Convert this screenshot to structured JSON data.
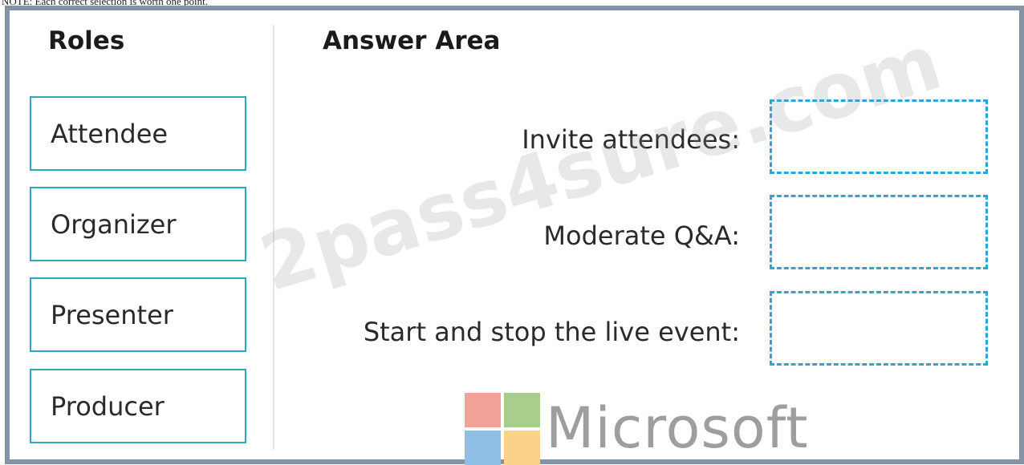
{
  "header_text": "NOTE: Each correct selection is worth one point.",
  "roles_panel": {
    "title": "Roles",
    "items": [
      {
        "label": "Attendee"
      },
      {
        "label": "Organizer"
      },
      {
        "label": "Presenter"
      },
      {
        "label": "Producer"
      }
    ]
  },
  "answer_area": {
    "title": "Answer Area",
    "questions": [
      {
        "label": "Invite attendees:"
      },
      {
        "label": "Moderate Q&A:"
      },
      {
        "label": "Start and stop the live event:"
      }
    ]
  },
  "watermark": "2pass4sure.com",
  "logo": {
    "text": "Microsoft",
    "colors": [
      "#f1a398",
      "#a9cd8c",
      "#8fbfe6",
      "#fbd28a"
    ]
  },
  "colors": {
    "frame": "#8494a8",
    "role_border": "#2ba8ba",
    "drop_zone_border": "#2fa3d6"
  }
}
